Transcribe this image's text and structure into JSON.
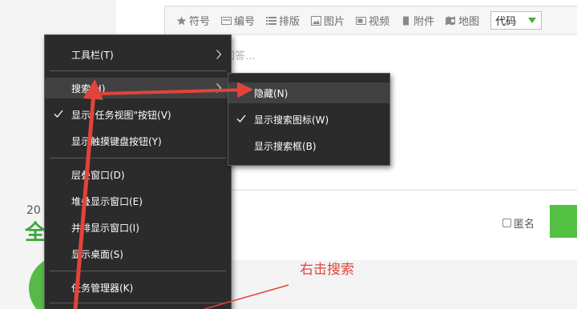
{
  "toolbar": {
    "items": [
      {
        "label": "符号",
        "icon": "star-icon"
      },
      {
        "label": "编号",
        "icon": "numbering-icon"
      },
      {
        "label": "排版",
        "icon": "list-icon"
      },
      {
        "label": "图片",
        "icon": "image-icon"
      },
      {
        "label": "视频",
        "icon": "video-icon"
      },
      {
        "label": "附件",
        "icon": "attachment-icon"
      },
      {
        "label": "地图",
        "icon": "map-icon"
      }
    ],
    "code_select": "代码"
  },
  "editor": {
    "placeholder_partial": "回答..."
  },
  "answer": {
    "anonymous_label": "匿名"
  },
  "background": {
    "year_partial": "20",
    "heading_partial": "全"
  },
  "context_menu": {
    "items": [
      {
        "label": "工具栏(T)",
        "submenu": true
      },
      {
        "label": "搜索(H)",
        "submenu": true,
        "highlighted": true
      },
      {
        "label": "显示\"任务视图\"按钮(V)",
        "checked": true
      },
      {
        "label": "显示触摸键盘按钮(Y)"
      },
      {
        "label": "层叠窗口(D)"
      },
      {
        "label": "堆叠显示窗口(E)"
      },
      {
        "label": "并排显示窗口(I)"
      },
      {
        "label": "显示桌面(S)"
      },
      {
        "label": "任务管理器(K)"
      }
    ]
  },
  "search_submenu": {
    "items": [
      {
        "label": "隐藏(N)",
        "highlighted": true
      },
      {
        "label": "显示搜索图标(W)",
        "checked": true
      },
      {
        "label": "显示搜索框(B)"
      }
    ]
  },
  "annotation": {
    "text": "右击搜索",
    "color": "#e2443a"
  },
  "colors": {
    "menu_bg": "#2b2b2b",
    "menu_highlight": "#414141",
    "accent_green": "#52c041",
    "annotation_red": "#e2443a"
  }
}
